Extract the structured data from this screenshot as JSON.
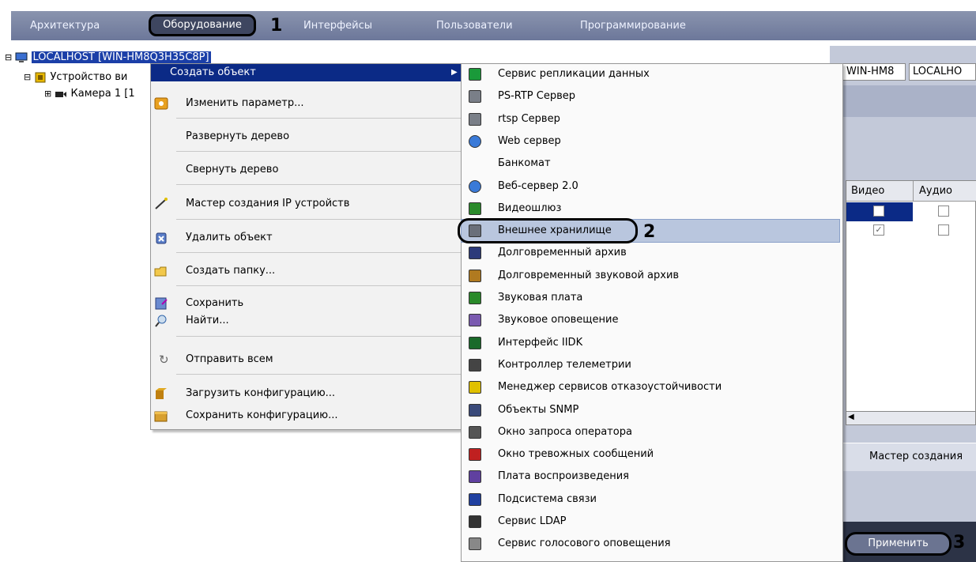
{
  "tabs": {
    "architecture": "Архитектура",
    "equipment": "Оборудование",
    "interfaces": "Интерфейсы",
    "users": "Пользователи",
    "programming": "Программирование"
  },
  "callouts": {
    "one": "1",
    "two": "2",
    "three": "3"
  },
  "tree": {
    "root": "LOCALHOST [WIN-HM8Q3H35C8P]",
    "device": "Устройство ви",
    "camera": "Камера 1 [1"
  },
  "right_panel": {
    "field1": "WIN-HM8",
    "field2": "LOCALHO",
    "col_video": "Видео",
    "col_audio": "Аудио",
    "wizard_button": "Мастер создания",
    "apply_button": "Применить"
  },
  "context_menu": {
    "create_object": "Создать объект",
    "change_param": "Изменить параметр...",
    "expand_tree": "Развернуть дерево",
    "collapse_tree": "Свернуть дерево",
    "ip_wizard": "Мастер создания IP устройств",
    "delete_object": "Удалить объект",
    "create_folder": "Создать папку...",
    "save": "Сохранить",
    "find": "Найти...",
    "send_all": "Отправить всем",
    "load_config": "Загрузить конфигурацию...",
    "save_config": "Сохранить конфигурацию..."
  },
  "submenu": [
    {
      "label": "Сервис репликации данных",
      "icon": "replication-icon"
    },
    {
      "label": "PS-RTP Сервер",
      "icon": "server-icon"
    },
    {
      "label": "rtsp Сервер",
      "icon": "server-icon"
    },
    {
      "label": "Web сервер",
      "icon": "globe-icon"
    },
    {
      "label": "Банкомат",
      "icon": ""
    },
    {
      "label": "Веб-сервер 2.0",
      "icon": "globe-icon"
    },
    {
      "label": "Видеошлюз",
      "icon": "gateway-icon"
    },
    {
      "label": "Внешнее хранилище",
      "icon": "storage-icon"
    },
    {
      "label": "Долговременный архив",
      "icon": "archive-icon"
    },
    {
      "label": "Долговременный звуковой архив",
      "icon": "audio-archive-icon"
    },
    {
      "label": "Звуковая плата",
      "icon": "sound-card-icon"
    },
    {
      "label": "Звуковое оповещение",
      "icon": "speaker-icon"
    },
    {
      "label": "Интерфейс IIDK",
      "icon": "iidk-icon"
    },
    {
      "label": "Контроллер телеметрии",
      "icon": "telemetry-icon"
    },
    {
      "label": "Менеджер сервисов отказоустойчивости",
      "icon": "failover-icon"
    },
    {
      "label": "Объекты SNMP",
      "icon": "snmp-icon"
    },
    {
      "label": "Окно запроса оператора",
      "icon": "hand-icon"
    },
    {
      "label": "Окно тревожных сообщений",
      "icon": "alarm-list-icon"
    },
    {
      "label": "Плата воспроизведения",
      "icon": "board-icon"
    },
    {
      "label": "Подсистема связи",
      "icon": "monitor-icon"
    },
    {
      "label": "Сервис LDAP",
      "icon": "ldap-icon"
    },
    {
      "label": "Сервис голосового оповещения",
      "icon": "voice-icon"
    }
  ]
}
